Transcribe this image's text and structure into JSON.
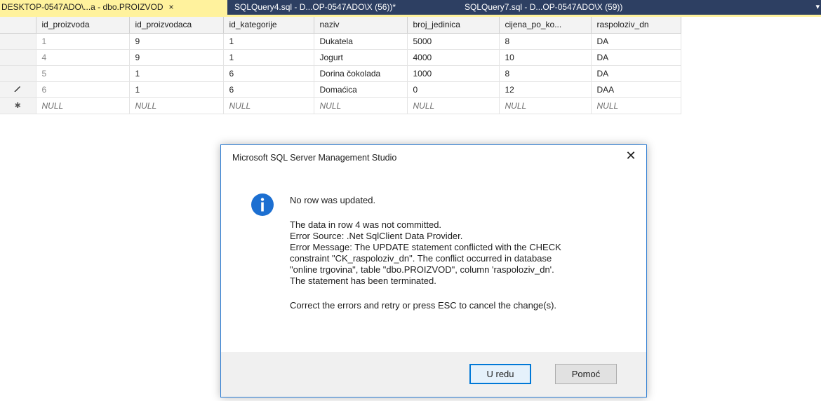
{
  "tabs": [
    {
      "label": "DESKTOP-0547ADO\\...a - dbo.PROIZVOD",
      "active": true
    },
    {
      "label": "SQLQuery4.sql - D...OP-0547ADO\\X (56))*",
      "active": false
    },
    {
      "label": "SQLQuery7.sql - D...OP-0547ADO\\X (59))",
      "active": false
    }
  ],
  "tab_close_glyph": "×",
  "grid": {
    "columns": [
      "id_proizvoda",
      "id_proizvodaca",
      "id_kategorije",
      "naziv",
      "broj_jedinica",
      "cijena_po_ko...",
      "raspoloziv_dn"
    ],
    "rows": [
      {
        "indicator": "",
        "cells": [
          "1",
          "9",
          "1",
          "Dukatela",
          "5000",
          "8",
          "DA"
        ]
      },
      {
        "indicator": "",
        "cells": [
          "4",
          "9",
          "1",
          "Jogurt",
          "4000",
          "10",
          "DA"
        ]
      },
      {
        "indicator": "",
        "cells": [
          "5",
          "1",
          "6",
          "Dorina čokolada",
          "1000",
          "8",
          "DA"
        ]
      },
      {
        "indicator": "pencil-icon",
        "cells": [
          "6",
          "1",
          "6",
          "Domaćica",
          "0",
          "12",
          "DAA"
        ]
      },
      {
        "indicator": "new-row-asterisk",
        "cells": [
          "NULL",
          "NULL",
          "NULL",
          "NULL",
          "NULL",
          "NULL",
          "NULL"
        ]
      }
    ]
  },
  "dialog": {
    "title": "Microsoft SQL Server Management Studio",
    "icon": "info-icon",
    "heading": "No row was updated.",
    "lines": [
      "The data in row 4 was not committed.",
      "Error Source: .Net SqlClient Data Provider.",
      "Error Message: The UPDATE statement conflicted with the CHECK",
      "constraint \"CK_raspoloziv_dn\". The conflict occurred in database",
      "\"online trgovina\", table \"dbo.PROIZVOD\", column 'raspoloziv_dn'.",
      "The statement has been terminated."
    ],
    "footer_note": "Correct the errors and retry or press ESC to cancel the change(s).",
    "ok_label": "U redu",
    "help_label": "Pomoć",
    "accent_color": "#2b7cd3",
    "info_icon_color": "#1c6fd1"
  },
  "colors": {
    "tabbar_bg": "#2d3f62",
    "active_tab_bg": "#fff29d"
  }
}
